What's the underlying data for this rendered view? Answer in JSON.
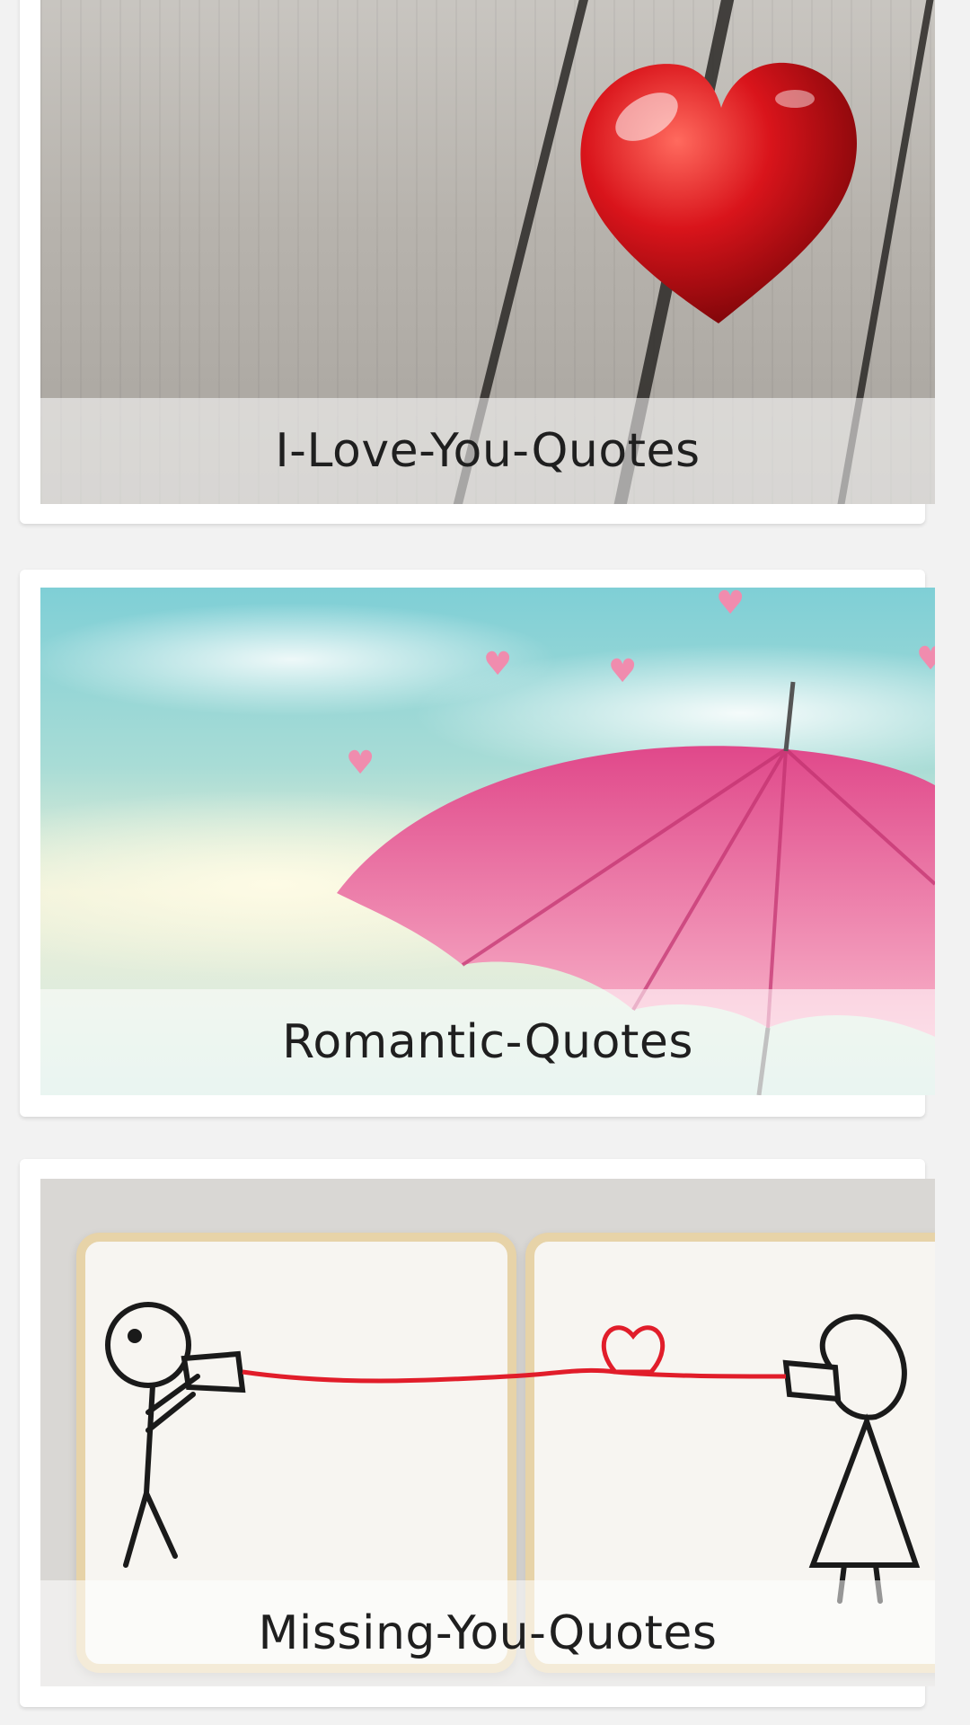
{
  "cards": [
    {
      "caption": "I-Love-You-Quotes",
      "image": "red-heart-on-wood"
    },
    {
      "caption": "Romantic-Quotes",
      "image": "pink-umbrella-sky"
    },
    {
      "caption": "Missing-You-Quotes",
      "image": "stick-figure-cookies"
    }
  ],
  "colors": {
    "background": "#f2f2f2",
    "card": "#ffffff",
    "caption_text": "#1f1f1f",
    "heart_red": "#d5151b",
    "umbrella_pink": "#ec7fa6"
  }
}
